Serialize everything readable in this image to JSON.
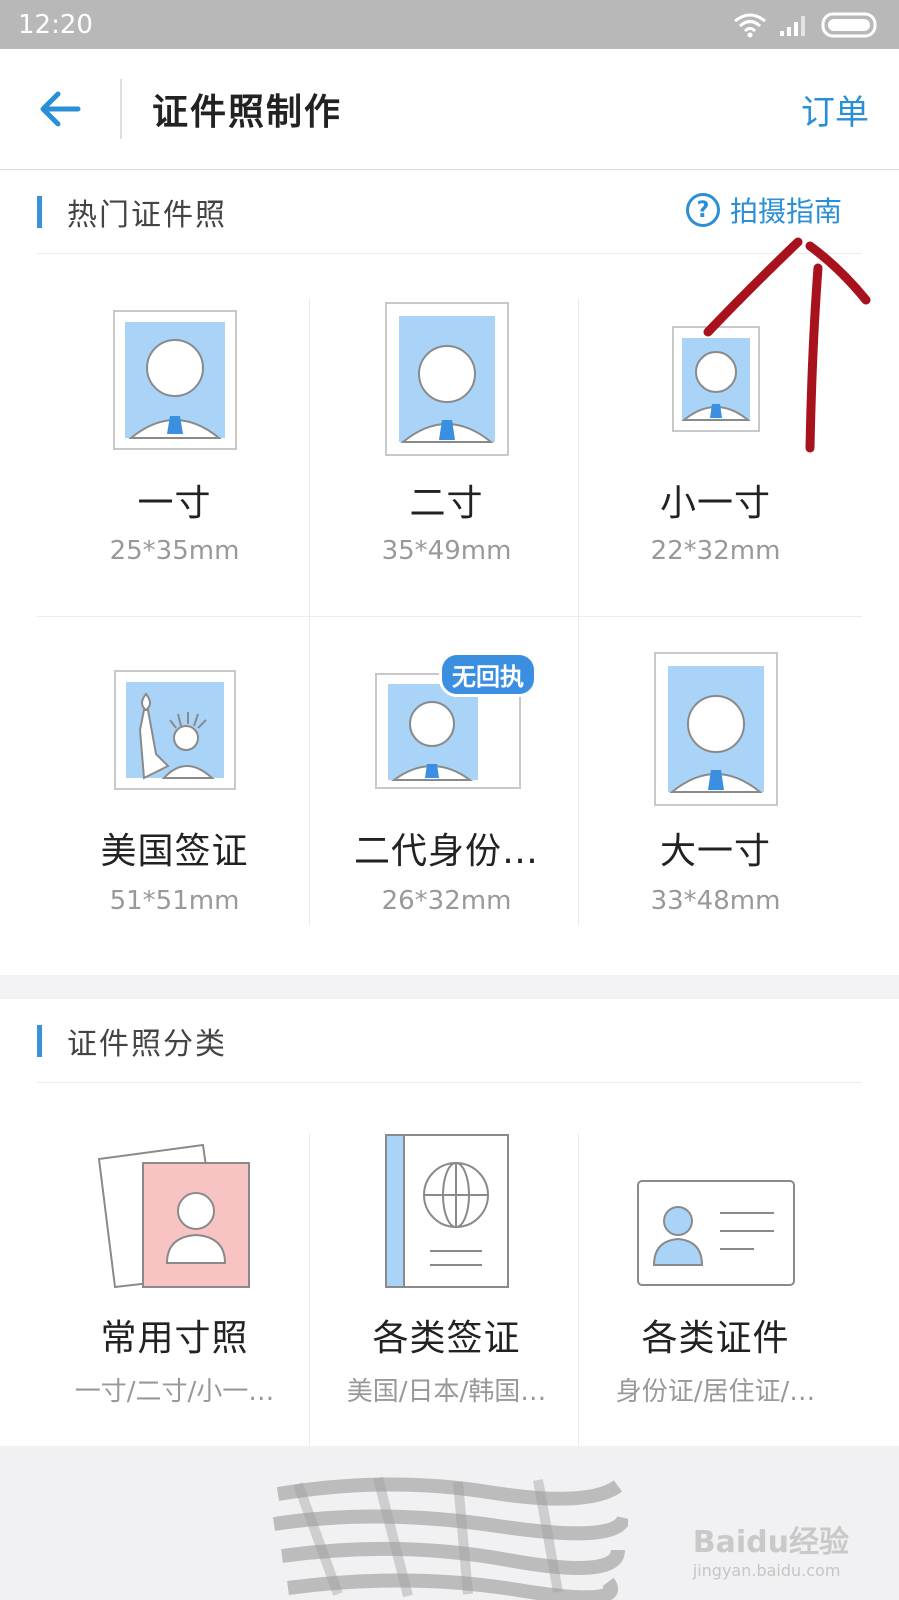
{
  "status_bar": {
    "time": "12:20"
  },
  "nav": {
    "title": "证件照制作",
    "action": "订单"
  },
  "hot": {
    "title": "热门证件照",
    "guide": "拍摄指南",
    "items": [
      {
        "name": "一寸",
        "size": "25*35mm"
      },
      {
        "name": "二寸",
        "size": "35*49mm"
      },
      {
        "name": "小一寸",
        "size": "22*32mm"
      },
      {
        "name": "美国签证",
        "size": "51*51mm"
      },
      {
        "name": "二代身份…",
        "size": "26*32mm",
        "badge": "无回执"
      },
      {
        "name": "大一寸",
        "size": "33*48mm"
      }
    ]
  },
  "category": {
    "title": "证件照分类",
    "items": [
      {
        "name": "常用寸照",
        "desc": "一寸/二寸/小一…"
      },
      {
        "name": "各类签证",
        "desc": "美国/日本/韩国…"
      },
      {
        "name": "各类证件",
        "desc": "身份证/居住证/…"
      }
    ]
  },
  "watermark": {
    "brand": "Baidu经验",
    "url": "jingyan.baidu.com"
  },
  "colors": {
    "accent": "#2a8fd6",
    "photo_bg": "#a9d3f7",
    "annotation": "#a8121c"
  }
}
